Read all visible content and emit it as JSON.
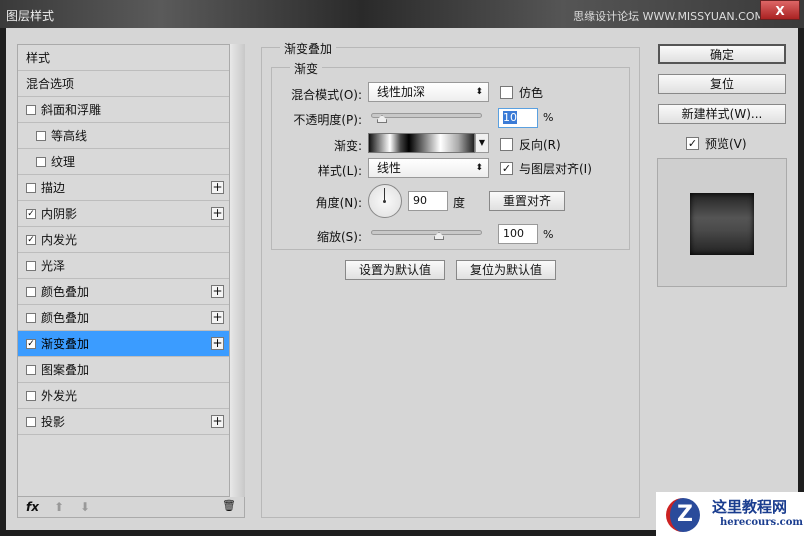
{
  "window": {
    "title": "图层样式",
    "brand": "思缘设计论坛 WWW.MISSYUAN.COM",
    "close": "X"
  },
  "styles_list": [
    {
      "label": "样式",
      "checkbox": false,
      "checked": false,
      "plus": false,
      "indent": 0
    },
    {
      "label": "混合选项",
      "checkbox": false,
      "checked": false,
      "plus": false,
      "indent": 0
    },
    {
      "label": "斜面和浮雕",
      "checkbox": true,
      "checked": false,
      "plus": false,
      "indent": 0
    },
    {
      "label": "等高线",
      "checkbox": true,
      "checked": false,
      "plus": false,
      "indent": 1
    },
    {
      "label": "纹理",
      "checkbox": true,
      "checked": false,
      "plus": false,
      "indent": 1
    },
    {
      "label": "描边",
      "checkbox": true,
      "checked": false,
      "plus": true,
      "indent": 0
    },
    {
      "label": "内阴影",
      "checkbox": true,
      "checked": true,
      "plus": true,
      "indent": 0
    },
    {
      "label": "内发光",
      "checkbox": true,
      "checked": true,
      "plus": false,
      "indent": 0
    },
    {
      "label": "光泽",
      "checkbox": true,
      "checked": false,
      "plus": false,
      "indent": 0
    },
    {
      "label": "颜色叠加",
      "checkbox": true,
      "checked": false,
      "plus": true,
      "indent": 0
    },
    {
      "label": "颜色叠加",
      "checkbox": true,
      "checked": false,
      "plus": true,
      "indent": 0
    },
    {
      "label": "渐变叠加",
      "checkbox": true,
      "checked": true,
      "plus": true,
      "indent": 0,
      "selected": true
    },
    {
      "label": "图案叠加",
      "checkbox": true,
      "checked": false,
      "plus": false,
      "indent": 0
    },
    {
      "label": "外发光",
      "checkbox": true,
      "checked": false,
      "plus": false,
      "indent": 0
    },
    {
      "label": "投影",
      "checkbox": true,
      "checked": false,
      "plus": true,
      "indent": 0
    }
  ],
  "toolbar": {
    "fx": "fx",
    "up": "⬆",
    "down": "⬇",
    "trash": "🗑"
  },
  "panel": {
    "title": "渐变叠加",
    "subtitle": "渐变",
    "blend_mode_label": "混合模式(O):",
    "blend_mode": "线性加深",
    "dither_label": "仿色",
    "dither": false,
    "opacity_label": "不透明度(P):",
    "opacity": "10",
    "opacity_unit": "%",
    "gradient_label": "渐变:",
    "reverse_label": "反向(R)",
    "reverse": false,
    "style_label": "样式(L):",
    "style": "线性",
    "align_label": "与图层对齐(I)",
    "align": true,
    "angle_label": "角度(N):",
    "angle": "90",
    "angle_unit": "度",
    "reset_align": "重置对齐",
    "scale_label": "缩放(S):",
    "scale": "100",
    "scale_unit": "%",
    "make_default": "设置为默认值",
    "reset_default": "复位为默认值"
  },
  "right": {
    "ok": "确定",
    "reset": "复位",
    "new_style": "新建样式(W)...",
    "preview_label": "预览(V)",
    "preview": true
  },
  "watermark": {
    "name": "这里教程网",
    "url": "herecours.com"
  }
}
